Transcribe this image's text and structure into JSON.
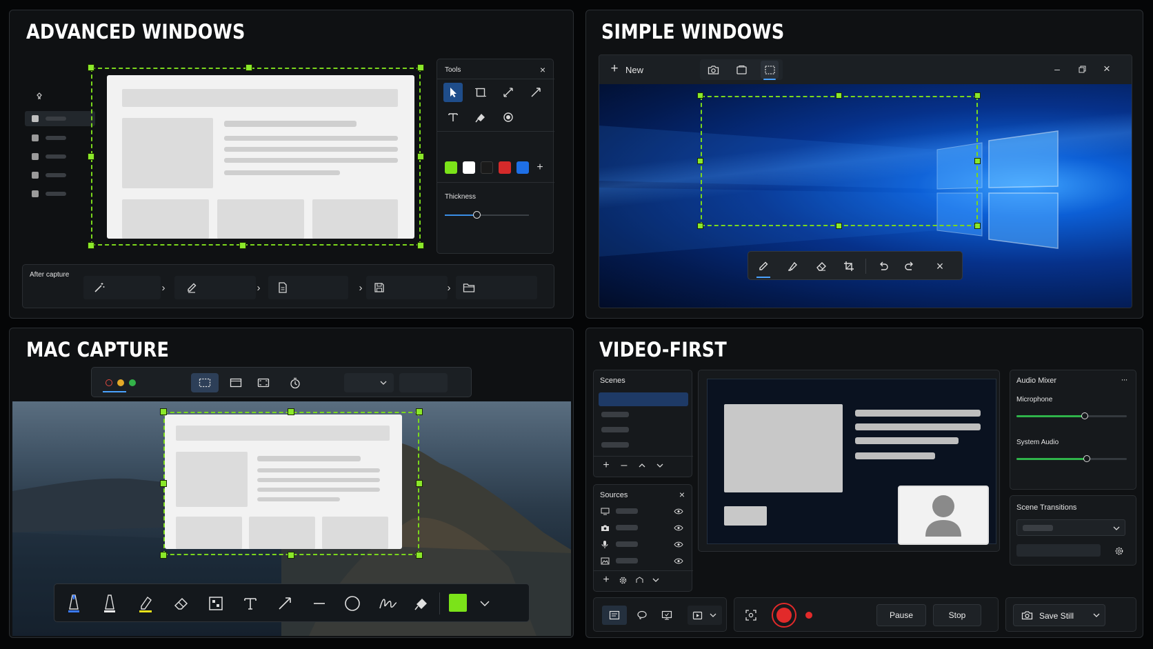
{
  "panels": {
    "advanced": {
      "title": "ADVANCED WINDOWS",
      "tools_label": "Tools",
      "thickness_label": "Thickness",
      "thickness_value": 0.38,
      "after_capture_label": "After capture",
      "colors": [
        "#7be319",
        "#ffffff",
        "#1a1a1a",
        "#d52a2a",
        "#1e6fe6"
      ]
    },
    "simple": {
      "title": "SIMPLE WINDOWS",
      "new_label": "New"
    },
    "mac": {
      "title": "MAC CAPTURE",
      "active_color": "#7be319"
    },
    "video": {
      "title": "VIDEO-FIRST",
      "scenes_label": "Scenes",
      "sources_label": "Sources",
      "audio_mixer_label": "Audio Mixer",
      "microphone_label": "Microphone",
      "microphone_level": 0.62,
      "system_audio_label": "System Audio",
      "system_audio_level": 0.64,
      "scene_transitions_label": "Scene Transitions",
      "pause_label": "Pause",
      "stop_label": "Stop",
      "save_still_label": "Save Still"
    }
  }
}
